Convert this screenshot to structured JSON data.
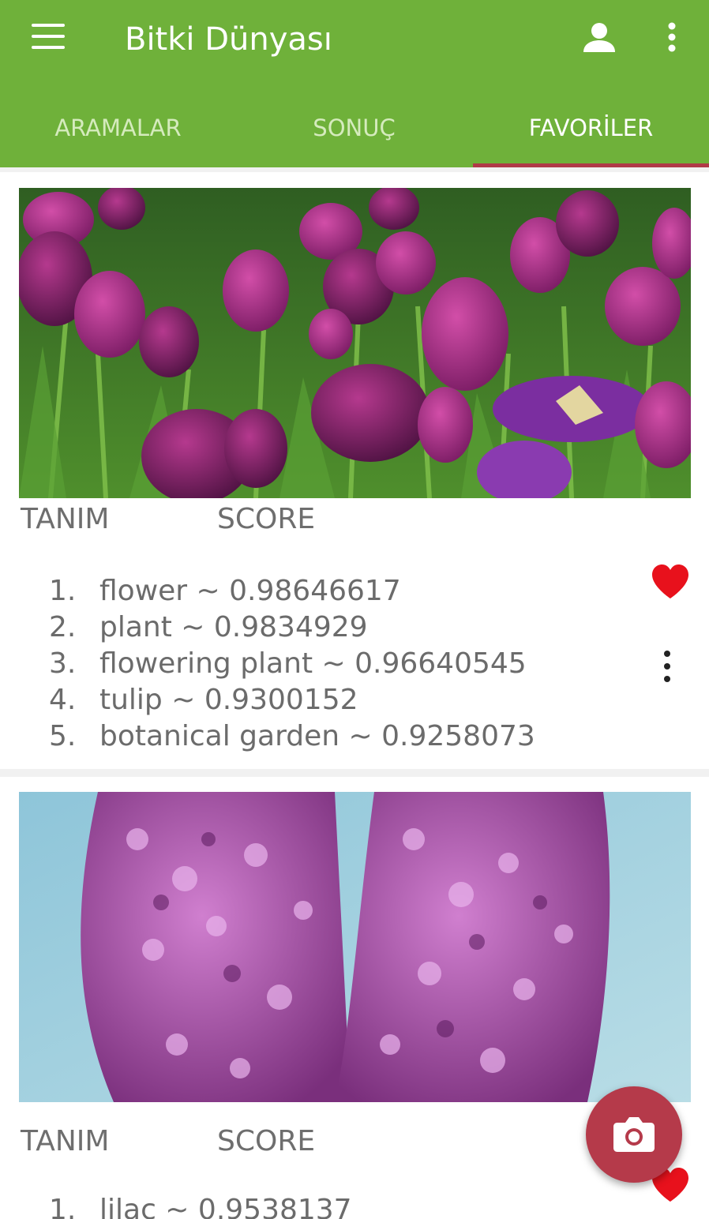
{
  "app": {
    "title": "Bitki Dünyası"
  },
  "icons": {
    "menu": "hamburger-menu-icon",
    "account": "person-icon",
    "more": "more-vert-icon",
    "favorite": "heart-icon",
    "item_more": "more-vert-icon",
    "camera": "camera-icon"
  },
  "colors": {
    "appbar": "#6fb13a",
    "tab_indicator": "#b03a48",
    "fab": "#b53a4a",
    "heart": "#e8111c"
  },
  "tabs": [
    {
      "label": "ARAMALAR",
      "selected": false
    },
    {
      "label": "SONUÇ",
      "selected": false
    },
    {
      "label": "FAVORİLER",
      "selected": true
    }
  ],
  "cards": [
    {
      "image": "purple tulips photo",
      "header_label": "TANIM",
      "score_label": "SCORE",
      "results": [
        {
          "num": "1.",
          "text": "flower ~ 0.98646617"
        },
        {
          "num": "2.",
          "text": "plant ~ 0.9834929"
        },
        {
          "num": "3.",
          "text": "flowering plant ~ 0.96640545"
        },
        {
          "num": "4.",
          "text": "tulip ~ 0.9300152"
        },
        {
          "num": "5.",
          "text": "botanical garden ~ 0.9258073"
        }
      ],
      "favorite": true
    },
    {
      "image": "lilac flowers photo",
      "header_label": "TANIM",
      "score_label": "SCORE",
      "results": [
        {
          "num": "1.",
          "text": "lilac ~ 0.9538137"
        }
      ],
      "favorite": true
    }
  ]
}
